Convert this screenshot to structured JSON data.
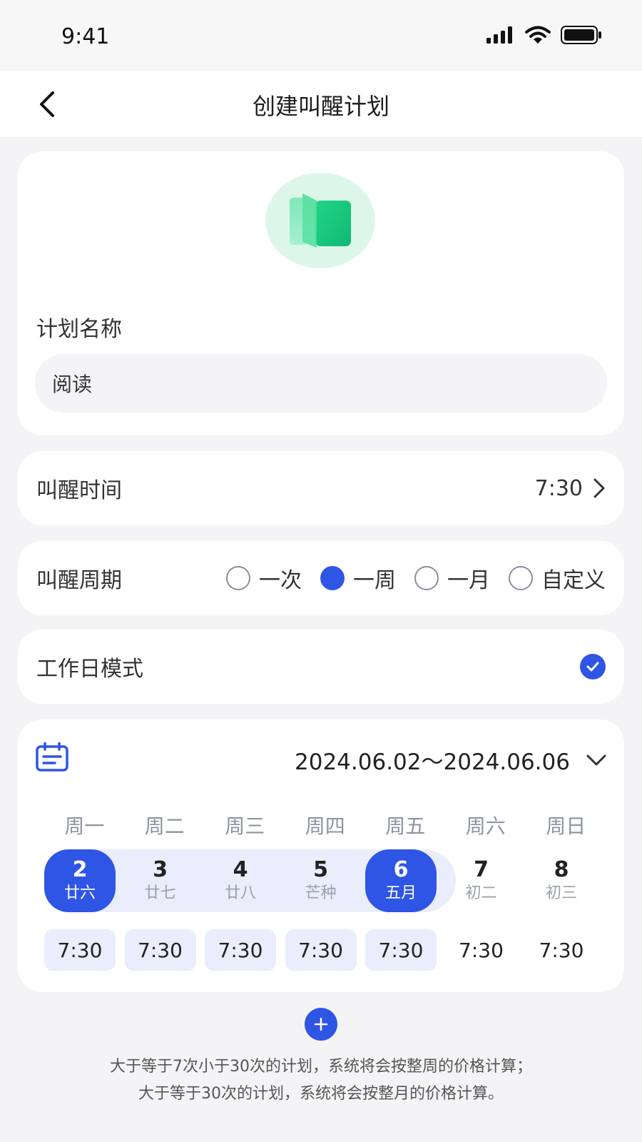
{
  "status_bar": {
    "time": "9:41"
  },
  "nav": {
    "title": "创建叫醒计划"
  },
  "plan": {
    "icon": "book-icon",
    "name_label": "计划名称",
    "name_value": "阅读"
  },
  "wake_time": {
    "label": "叫醒时间",
    "value": "7:30"
  },
  "cycle": {
    "label": "叫醒周期",
    "options": [
      {
        "label": "一次",
        "checked": false
      },
      {
        "label": "一周",
        "checked": true
      },
      {
        "label": "一月",
        "checked": false
      },
      {
        "label": "自定义",
        "checked": false
      }
    ]
  },
  "workday": {
    "label": "工作日模式",
    "checked": true
  },
  "calendar": {
    "range": "2024.06.02～2024.06.06",
    "weekdays": [
      "周一",
      "周二",
      "周三",
      "周四",
      "周五",
      "周六",
      "周日"
    ],
    "days": [
      {
        "num": "2",
        "lunar": "廿六",
        "state": "selected"
      },
      {
        "num": "3",
        "lunar": "廿七",
        "state": "in-range"
      },
      {
        "num": "4",
        "lunar": "廿八",
        "state": "in-range"
      },
      {
        "num": "5",
        "lunar": "芒种",
        "state": "in-range"
      },
      {
        "num": "6",
        "lunar": "五月",
        "state": "selected"
      },
      {
        "num": "7",
        "lunar": "初二",
        "state": "none"
      },
      {
        "num": "8",
        "lunar": "初三",
        "state": "none"
      }
    ],
    "times": [
      "7:30",
      "7:30",
      "7:30",
      "7:30",
      "7:30",
      "7:30",
      "7:30"
    ]
  },
  "notes": [
    "大于等于7次小于30次的计划，系统将会按整周的价格计算；",
    "大于等于30次的计划，系统将会按整月的价格计算。"
  ],
  "colors": {
    "accent": "#2f55e4",
    "range_bg": "#eaedfb",
    "icon_bg": "#dcf7ea"
  }
}
